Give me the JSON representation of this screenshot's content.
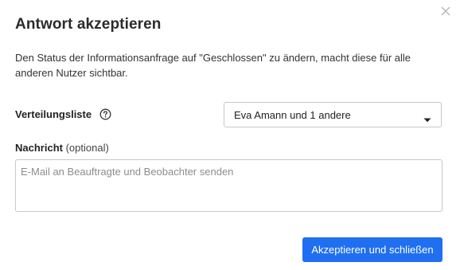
{
  "dialog": {
    "title": "Antwort akzeptieren",
    "description": "Den Status der Informationsanfrage auf \"Geschlossen\" zu ändern, macht diese für alle anderen Nutzer sichtbar.",
    "close_icon": "close-icon"
  },
  "distribution": {
    "label": "Verteilungsliste",
    "help_icon": "question-circle-icon",
    "selected_value": "Eva Amann und 1 andere",
    "caret_icon": "caret-down-icon"
  },
  "message": {
    "label": "Nachricht",
    "optional_suffix": "(optional)",
    "value": "",
    "placeholder": "E-Mail an Beauftragte und Beobachter senden"
  },
  "actions": {
    "primary_label": "Akzeptieren und schließen"
  },
  "colors": {
    "primary": "#1f6ff0",
    "border": "#c8c8c8",
    "placeholder": "#8d8d8d"
  }
}
